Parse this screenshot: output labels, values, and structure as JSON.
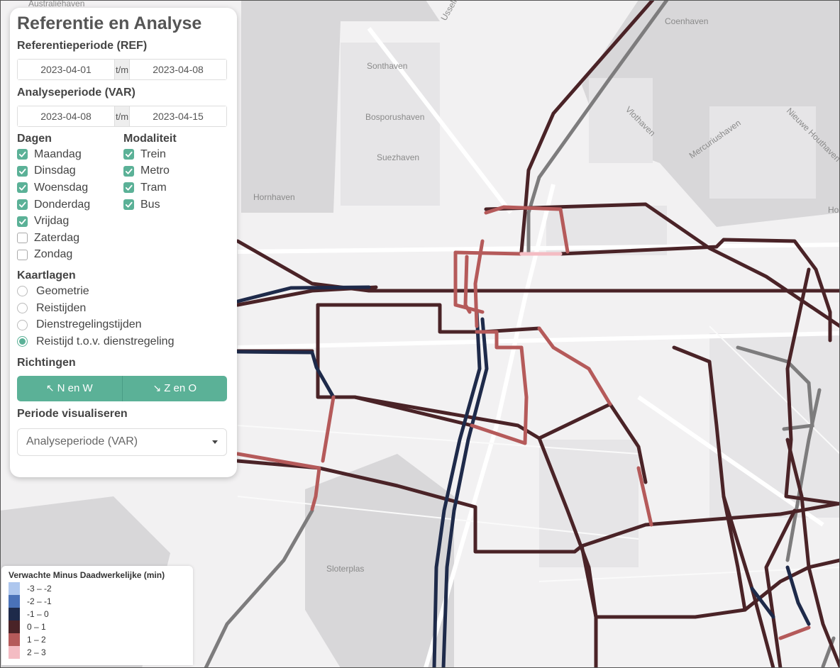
{
  "panel": {
    "title": "Referentie en Analyse",
    "ref_label": "Referentieperiode (REF)",
    "ref_start": "2023-04-01",
    "ref_end": "2023-04-08",
    "var_label": "Analyseperiode (VAR)",
    "var_start": "2023-04-08",
    "var_end": "2023-04-15",
    "range_sep": "t/m",
    "days_label": "Dagen",
    "days": [
      {
        "label": "Maandag",
        "checked": true
      },
      {
        "label": "Dinsdag",
        "checked": true
      },
      {
        "label": "Woensdag",
        "checked": true
      },
      {
        "label": "Donderdag",
        "checked": true
      },
      {
        "label": "Vrijdag",
        "checked": true
      },
      {
        "label": "Zaterdag",
        "checked": false
      },
      {
        "label": "Zondag",
        "checked": false
      }
    ],
    "modality_label": "Modaliteit",
    "modalities": [
      {
        "label": "Trein",
        "checked": true
      },
      {
        "label": "Metro",
        "checked": true
      },
      {
        "label": "Tram",
        "checked": true
      },
      {
        "label": "Bus",
        "checked": true
      }
    ],
    "layers_label": "Kaartlagen",
    "layers": [
      {
        "label": "Geometrie",
        "selected": false
      },
      {
        "label": "Reistijden",
        "selected": false
      },
      {
        "label": "Dienstregelingstijden",
        "selected": false
      },
      {
        "label": "Reistijd t.o.v. dienstregeling",
        "selected": true
      }
    ],
    "directions_label": "Richtingen",
    "dir_nw": "N en W",
    "dir_zo": "Z en O",
    "period_label": "Periode visualiseren",
    "period_value": "Analyseperiode (VAR)"
  },
  "legend": {
    "title": "Verwachte Minus Daadwerkelijke (min)",
    "items": [
      {
        "label": "-3 – -2",
        "color": "#aec7ee"
      },
      {
        "label": "-2 – -1",
        "color": "#4a72b8"
      },
      {
        "label": "-1 – 0",
        "color": "#1e2a4a"
      },
      {
        "label": "0 – 1",
        "color": "#4a2327"
      },
      {
        "label": "1 – 2",
        "color": "#b55a5a"
      },
      {
        "label": "2 – 3",
        "color": "#f4bcc3"
      }
    ]
  },
  "map": {
    "place_labels": [
      "Australiëhaven",
      "Coenhaven",
      "Usselhaven",
      "Sonthaven",
      "Bosporushaven",
      "Suezhaven",
      "Hornhaven",
      "Vlothaven",
      "Mercuriushaven",
      "Nieuwe Houthaven",
      "Sloterplas",
      "Ho"
    ]
  }
}
